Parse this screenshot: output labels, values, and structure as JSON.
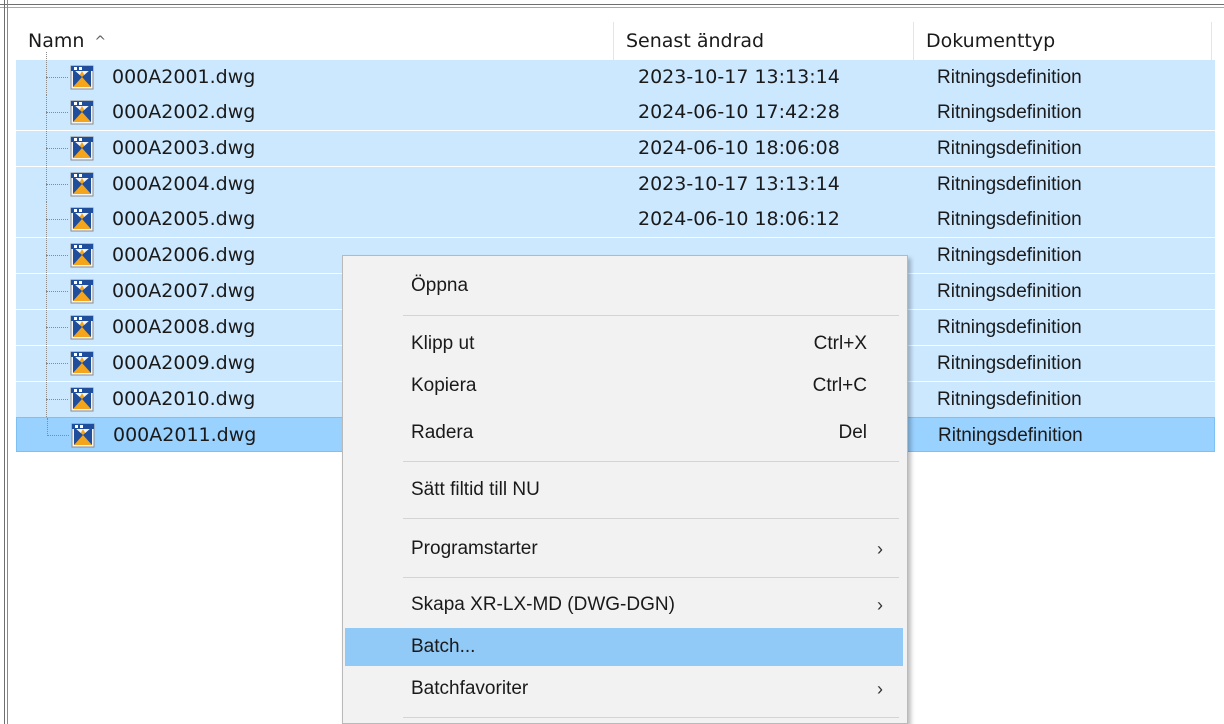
{
  "columns": {
    "name": "Namn",
    "modified": "Senast ändrad",
    "type": "Dokumenttyp"
  },
  "icons": {
    "sort": "chevron-up-icon",
    "file": "dwg-drawing-icon",
    "submenu": "chevron-right-icon"
  },
  "files": [
    {
      "name": "000A2001.dwg",
      "modified": "2023-10-17 13:13:14",
      "type": "Ritningsdefinition"
    },
    {
      "name": "000A2002.dwg",
      "modified": "2024-06-10 17:42:28",
      "type": "Ritningsdefinition"
    },
    {
      "name": "000A2003.dwg",
      "modified": "2024-06-10 18:06:08",
      "type": "Ritningsdefinition"
    },
    {
      "name": "000A2004.dwg",
      "modified": "2023-10-17 13:13:14",
      "type": "Ritningsdefinition"
    },
    {
      "name": "000A2005.dwg",
      "modified": "2024-06-10 18:06:12",
      "type": "Ritningsdefinition"
    },
    {
      "name": "000A2006.dwg",
      "modified": "",
      "type": "Ritningsdefinition"
    },
    {
      "name": "000A2007.dwg",
      "modified": "",
      "type": "Ritningsdefinition"
    },
    {
      "name": "000A2008.dwg",
      "modified": "",
      "type": "Ritningsdefinition"
    },
    {
      "name": "000A2009.dwg",
      "modified": "",
      "type": "Ritningsdefinition"
    },
    {
      "name": "000A2010.dwg",
      "modified": "",
      "type": "Ritningsdefinition"
    },
    {
      "name": "000A2011.dwg",
      "modified": "",
      "type": "Ritningsdefinition"
    }
  ],
  "context_menu": {
    "open": "Öppna",
    "cut": "Klipp ut",
    "cut_shortcut": "Ctrl+X",
    "copy": "Kopiera",
    "copy_shortcut": "Ctrl+C",
    "delete": "Radera",
    "delete_shortcut": "Del",
    "set_filetime": "Sätt filtid till NU",
    "program_starter": "Programstarter",
    "create_xr": "Skapa XR-LX-MD (DWG-DGN)",
    "batch": "Batch...",
    "batch_favorites": "Batchfavoriter",
    "arrow": "›"
  },
  "colors": {
    "selection": "#cce8ff",
    "focused_selection": "#99d1ff",
    "menu_highlight": "#91c9f7"
  }
}
